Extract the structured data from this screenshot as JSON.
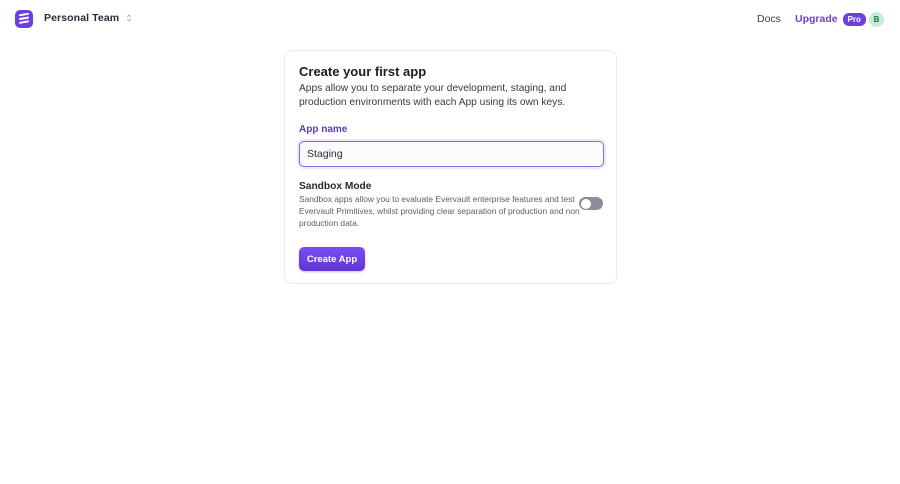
{
  "header": {
    "team_name": "Personal Team",
    "docs_label": "Docs",
    "upgrade_label": "Upgrade",
    "pro_badge": "Pro",
    "avatar_initial": "B"
  },
  "card": {
    "title": "Create your first app",
    "description": "Apps allow you to separate your development, staging, and production environments with each App using its own keys.",
    "app_name_label": "App name",
    "app_name_value": "Staging",
    "sandbox_title": "Sandbox Mode",
    "sandbox_description": "Sandbox apps allow you to evaluate Evervault enterprise features and test Evervault Primitives, whilst providing clear separation of production and non production data.",
    "sandbox_enabled": false,
    "create_button_label": "Create App"
  },
  "colors": {
    "accent": "#6d3fe0",
    "avatar_bg": "#c6ecd4",
    "toggle_off": "#8f8c99"
  },
  "icons": {
    "logo": "evervault-logo-icon",
    "team_switcher": "chevron-updown-icon"
  }
}
